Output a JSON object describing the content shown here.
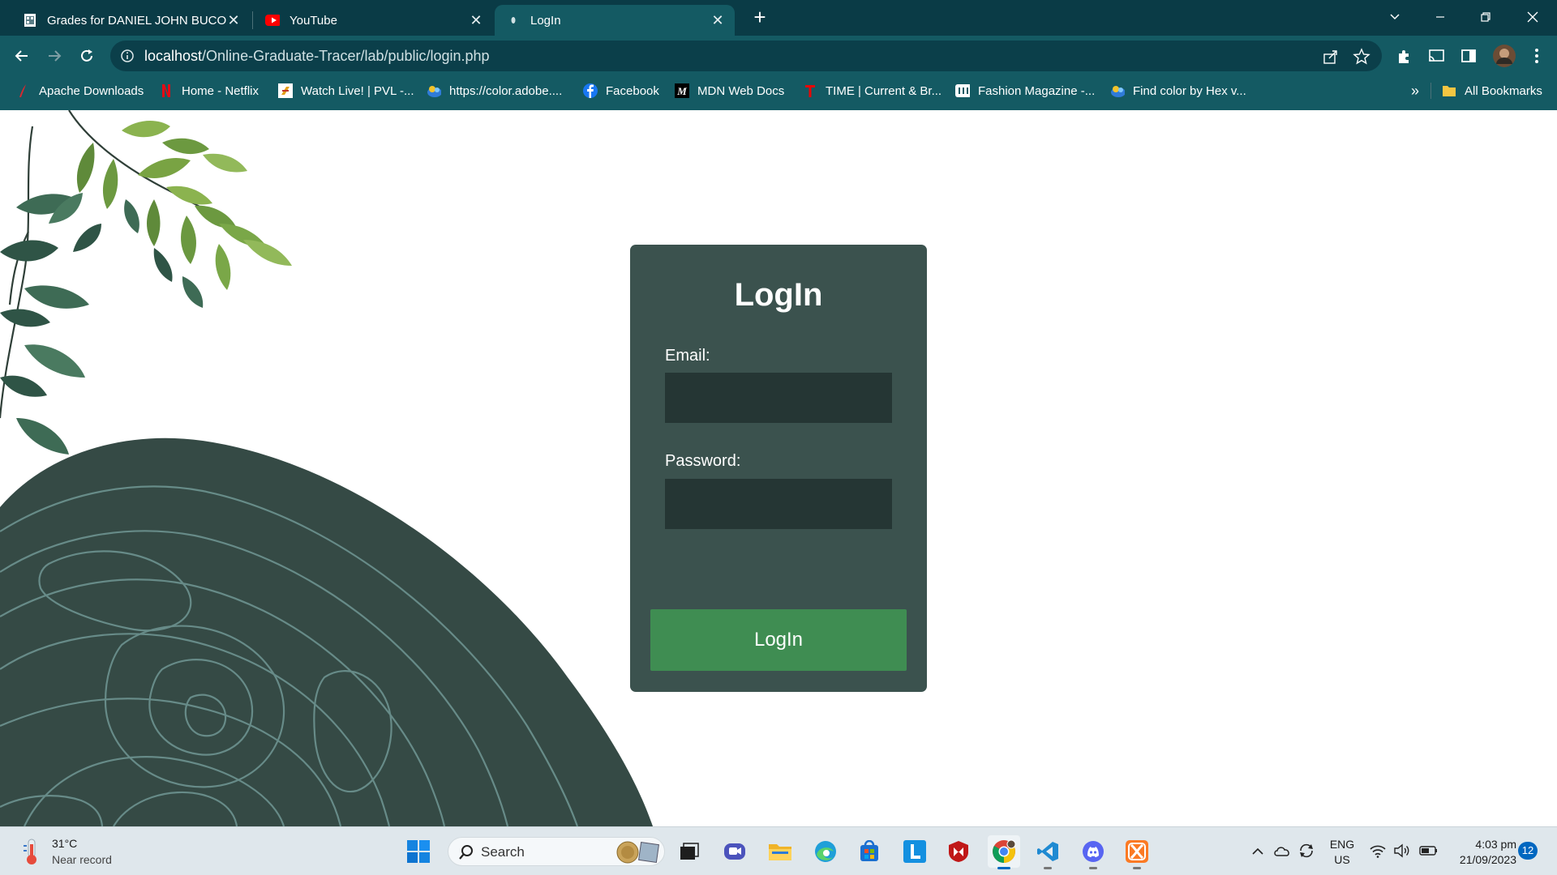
{
  "browser": {
    "tabs": [
      {
        "title": "Grades for DANIEL JOHN BUCO",
        "favicon": "document-icon",
        "active": false
      },
      {
        "title": "YouTube",
        "favicon": "youtube-icon",
        "active": false
      },
      {
        "title": "LogIn",
        "favicon": "loading-icon",
        "active": true
      }
    ],
    "address": {
      "host": "localhost",
      "path": "/Online-Graduate-Tracer/lab/public/login.php"
    },
    "bookmarks": [
      {
        "label": "Apache Downloads",
        "icon": "apache-feather-icon"
      },
      {
        "label": "Home - Netflix",
        "icon": "netflix-icon"
      },
      {
        "label": "Watch Live! | PVL -...",
        "icon": "pvl-icon"
      },
      {
        "label": "https://color.adobe....",
        "icon": "adobe-color-icon"
      },
      {
        "label": "Facebook",
        "icon": "facebook-icon"
      },
      {
        "label": "MDN Web Docs",
        "icon": "mdn-icon"
      },
      {
        "label": "TIME | Current & Br...",
        "icon": "time-icon"
      },
      {
        "label": "Fashion Magazine -...",
        "icon": "magazine-icon"
      },
      {
        "label": "Find color by Hex v...",
        "icon": "color-hex-icon"
      }
    ],
    "overflow_label": "»",
    "all_bookmarks_label": "All Bookmarks"
  },
  "page": {
    "title": "LogIn",
    "email_label": "Email:",
    "email_value": "",
    "password_label": "Password:",
    "password_value": "",
    "submit_label": "LogIn",
    "colors": {
      "card": "#3b524e",
      "input": "#253634",
      "button": "#3f8d52",
      "blob": "#354a45",
      "contour": "#6a8f8c"
    }
  },
  "taskbar": {
    "weather_temp": "31°C",
    "weather_desc": "Near record",
    "search_placeholder": "Search",
    "apps": [
      "windows-start-icon",
      "task-view-icon",
      "teams-icon",
      "file-explorer-icon",
      "edge-icon",
      "store-icon",
      "l-app-icon",
      "mcafee-icon",
      "chrome-icon",
      "vscode-icon",
      "discord-icon",
      "xampp-icon"
    ],
    "lang_line1": "ENG",
    "lang_line2": "US",
    "time": "4:03 pm",
    "date": "21/09/2023",
    "notifications": "12"
  }
}
